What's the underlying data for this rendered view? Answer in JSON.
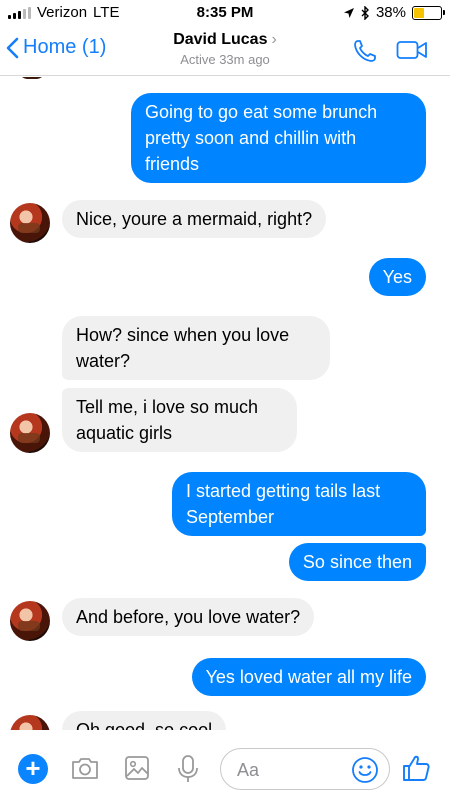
{
  "status_bar": {
    "carrier": "Verizon",
    "network": "LTE",
    "time": "8:35 PM",
    "battery_percent": "38%",
    "battery_level": 0.38
  },
  "header": {
    "back_label": "Home (1)",
    "contact_name": "David Lucas",
    "contact_status": "Active 33m ago"
  },
  "messages": [
    {
      "sender": "me",
      "text": "Going to go eat some brunch pretty soon and chillin with friends"
    },
    {
      "sender": "them",
      "text": "Nice, youre a mermaid, right?"
    },
    {
      "sender": "me",
      "text": "Yes"
    },
    {
      "sender": "them",
      "text": "How? since when you love water?"
    },
    {
      "sender": "them",
      "text": "Tell me, i love so much aquatic girls"
    },
    {
      "sender": "me",
      "text": "I started getting tails last September"
    },
    {
      "sender": "me",
      "text": "So since then"
    },
    {
      "sender": "them",
      "text": "And before, you love water?"
    },
    {
      "sender": "me",
      "text": "Yes loved water all my life"
    },
    {
      "sender": "them",
      "text": "Oh good, so cool"
    }
  ],
  "composer": {
    "placeholder": "Aa",
    "value": ""
  },
  "colors": {
    "accent": "#147efb",
    "outgoing_bubble": "#0084ff",
    "incoming_bubble": "#f1f0f0"
  }
}
